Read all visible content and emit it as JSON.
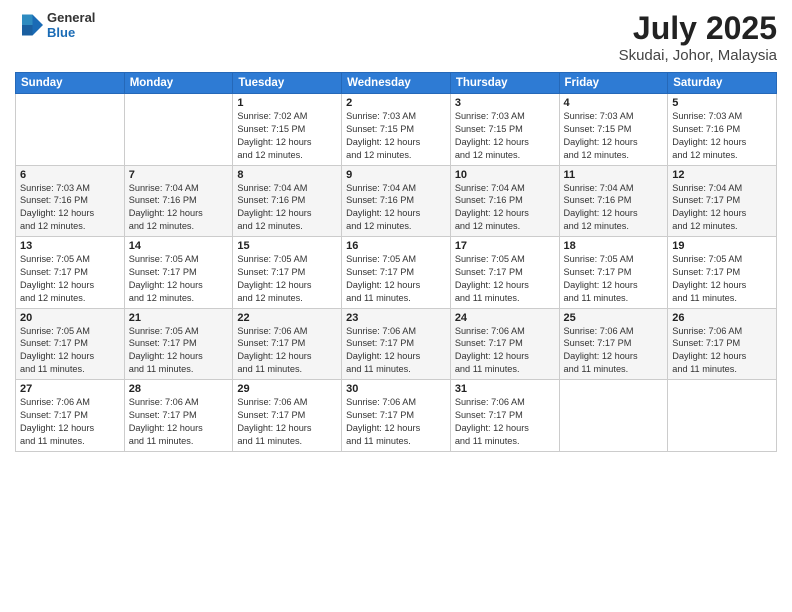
{
  "logo": {
    "line1": "General",
    "line2": "Blue"
  },
  "title": "July 2025",
  "subtitle": "Skudai, Johor, Malaysia",
  "weekdays": [
    "Sunday",
    "Monday",
    "Tuesday",
    "Wednesday",
    "Thursday",
    "Friday",
    "Saturday"
  ],
  "weeks": [
    [
      {
        "day": "",
        "info": ""
      },
      {
        "day": "",
        "info": ""
      },
      {
        "day": "1",
        "info": "Sunrise: 7:02 AM\nSunset: 7:15 PM\nDaylight: 12 hours\nand 12 minutes."
      },
      {
        "day": "2",
        "info": "Sunrise: 7:03 AM\nSunset: 7:15 PM\nDaylight: 12 hours\nand 12 minutes."
      },
      {
        "day": "3",
        "info": "Sunrise: 7:03 AM\nSunset: 7:15 PM\nDaylight: 12 hours\nand 12 minutes."
      },
      {
        "day": "4",
        "info": "Sunrise: 7:03 AM\nSunset: 7:15 PM\nDaylight: 12 hours\nand 12 minutes."
      },
      {
        "day": "5",
        "info": "Sunrise: 7:03 AM\nSunset: 7:16 PM\nDaylight: 12 hours\nand 12 minutes."
      }
    ],
    [
      {
        "day": "6",
        "info": "Sunrise: 7:03 AM\nSunset: 7:16 PM\nDaylight: 12 hours\nand 12 minutes."
      },
      {
        "day": "7",
        "info": "Sunrise: 7:04 AM\nSunset: 7:16 PM\nDaylight: 12 hours\nand 12 minutes."
      },
      {
        "day": "8",
        "info": "Sunrise: 7:04 AM\nSunset: 7:16 PM\nDaylight: 12 hours\nand 12 minutes."
      },
      {
        "day": "9",
        "info": "Sunrise: 7:04 AM\nSunset: 7:16 PM\nDaylight: 12 hours\nand 12 minutes."
      },
      {
        "day": "10",
        "info": "Sunrise: 7:04 AM\nSunset: 7:16 PM\nDaylight: 12 hours\nand 12 minutes."
      },
      {
        "day": "11",
        "info": "Sunrise: 7:04 AM\nSunset: 7:16 PM\nDaylight: 12 hours\nand 12 minutes."
      },
      {
        "day": "12",
        "info": "Sunrise: 7:04 AM\nSunset: 7:17 PM\nDaylight: 12 hours\nand 12 minutes."
      }
    ],
    [
      {
        "day": "13",
        "info": "Sunrise: 7:05 AM\nSunset: 7:17 PM\nDaylight: 12 hours\nand 12 minutes."
      },
      {
        "day": "14",
        "info": "Sunrise: 7:05 AM\nSunset: 7:17 PM\nDaylight: 12 hours\nand 12 minutes."
      },
      {
        "day": "15",
        "info": "Sunrise: 7:05 AM\nSunset: 7:17 PM\nDaylight: 12 hours\nand 12 minutes."
      },
      {
        "day": "16",
        "info": "Sunrise: 7:05 AM\nSunset: 7:17 PM\nDaylight: 12 hours\nand 11 minutes."
      },
      {
        "day": "17",
        "info": "Sunrise: 7:05 AM\nSunset: 7:17 PM\nDaylight: 12 hours\nand 11 minutes."
      },
      {
        "day": "18",
        "info": "Sunrise: 7:05 AM\nSunset: 7:17 PM\nDaylight: 12 hours\nand 11 minutes."
      },
      {
        "day": "19",
        "info": "Sunrise: 7:05 AM\nSunset: 7:17 PM\nDaylight: 12 hours\nand 11 minutes."
      }
    ],
    [
      {
        "day": "20",
        "info": "Sunrise: 7:05 AM\nSunset: 7:17 PM\nDaylight: 12 hours\nand 11 minutes."
      },
      {
        "day": "21",
        "info": "Sunrise: 7:05 AM\nSunset: 7:17 PM\nDaylight: 12 hours\nand 11 minutes."
      },
      {
        "day": "22",
        "info": "Sunrise: 7:06 AM\nSunset: 7:17 PM\nDaylight: 12 hours\nand 11 minutes."
      },
      {
        "day": "23",
        "info": "Sunrise: 7:06 AM\nSunset: 7:17 PM\nDaylight: 12 hours\nand 11 minutes."
      },
      {
        "day": "24",
        "info": "Sunrise: 7:06 AM\nSunset: 7:17 PM\nDaylight: 12 hours\nand 11 minutes."
      },
      {
        "day": "25",
        "info": "Sunrise: 7:06 AM\nSunset: 7:17 PM\nDaylight: 12 hours\nand 11 minutes."
      },
      {
        "day": "26",
        "info": "Sunrise: 7:06 AM\nSunset: 7:17 PM\nDaylight: 12 hours\nand 11 minutes."
      }
    ],
    [
      {
        "day": "27",
        "info": "Sunrise: 7:06 AM\nSunset: 7:17 PM\nDaylight: 12 hours\nand 11 minutes."
      },
      {
        "day": "28",
        "info": "Sunrise: 7:06 AM\nSunset: 7:17 PM\nDaylight: 12 hours\nand 11 minutes."
      },
      {
        "day": "29",
        "info": "Sunrise: 7:06 AM\nSunset: 7:17 PM\nDaylight: 12 hours\nand 11 minutes."
      },
      {
        "day": "30",
        "info": "Sunrise: 7:06 AM\nSunset: 7:17 PM\nDaylight: 12 hours\nand 11 minutes."
      },
      {
        "day": "31",
        "info": "Sunrise: 7:06 AM\nSunset: 7:17 PM\nDaylight: 12 hours\nand 11 minutes."
      },
      {
        "day": "",
        "info": ""
      },
      {
        "day": "",
        "info": ""
      }
    ]
  ]
}
